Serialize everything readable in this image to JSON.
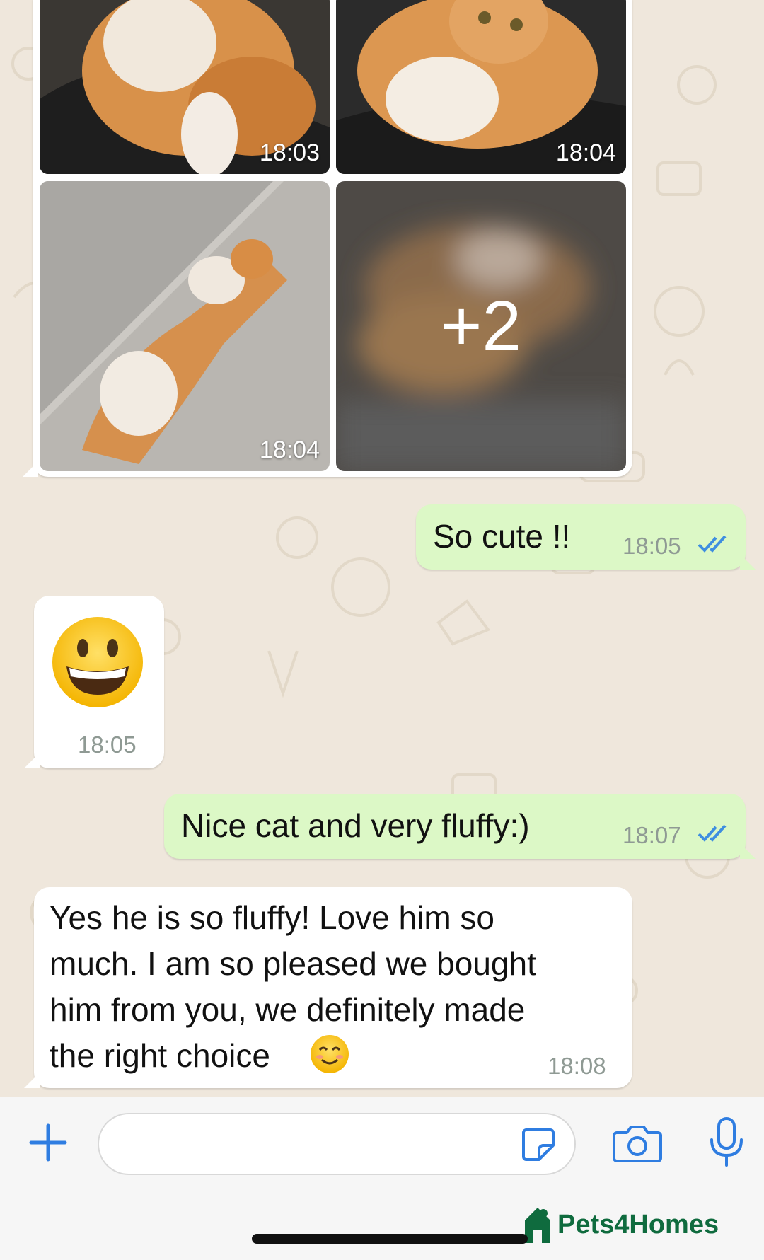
{
  "photos": {
    "time_1": "18:03",
    "time_2": "18:04",
    "time_3": "18:04",
    "more_count": "+2"
  },
  "messages": [
    {
      "direction": "outgoing",
      "text": "So cute !!",
      "time": "18:05",
      "status": "read"
    },
    {
      "direction": "incoming",
      "emoji": "😀",
      "time": "18:05"
    },
    {
      "direction": "outgoing",
      "text": "Nice cat and very fluffy:)",
      "time": "18:07",
      "status": "read"
    },
    {
      "direction": "incoming",
      "lines": [
        "Yes he is so fluffy! Love him so",
        "much. I am so pleased we bought",
        "him from you, we definitely made",
        "the right choice"
      ],
      "emoji": "😊",
      "time": "18:08"
    }
  ],
  "input": {
    "placeholder": ""
  },
  "icons": [
    "plus-icon",
    "sticker-icon",
    "camera-icon",
    "microphone-icon"
  ],
  "watermark": {
    "text": "Pets4Homes"
  },
  "colors": {
    "accent": "#2f7de1",
    "outgoing_bubble": "#dcf8c6",
    "incoming_bubble": "#ffffff",
    "background": "#efe7dc",
    "read_ticks": "#3e8ee0",
    "brand": "#0f6b3e"
  }
}
